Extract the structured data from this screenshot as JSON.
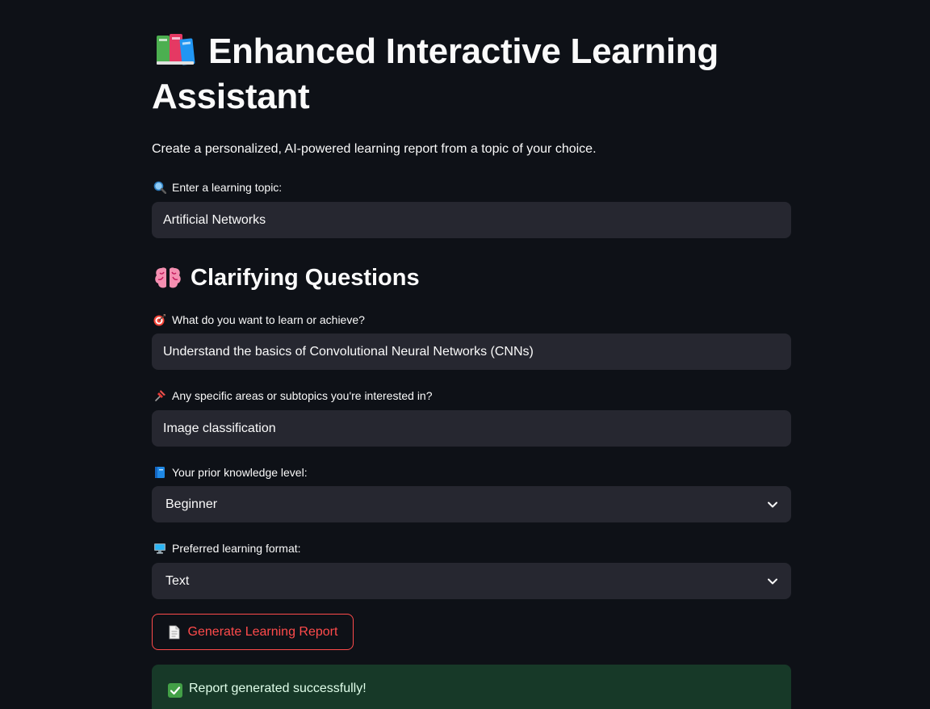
{
  "header": {
    "title": "Enhanced Interactive Learning Assistant",
    "title_icon": "books-icon",
    "subtitle": "Create a personalized, AI-powered learning report from a topic of your choice."
  },
  "topic": {
    "label": "Enter a learning topic:",
    "icon": "magnifier-icon",
    "value": "Artificial Networks"
  },
  "clarifying": {
    "heading": "Clarifying Questions",
    "icon": "brain-icon",
    "goal": {
      "label": "What do you want to learn or achieve?",
      "icon": "target-icon",
      "value": "Understand the basics of Convolutional Neural Networks (CNNs)"
    },
    "areas": {
      "label": "Any specific areas or subtopics you're interested in?",
      "icon": "pushpin-icon",
      "value": "Image classification"
    },
    "knowledge": {
      "label": "Your prior knowledge level:",
      "icon": "blue-book-icon",
      "selected": "Beginner"
    },
    "format": {
      "label": "Preferred learning format:",
      "icon": "computer-icon",
      "selected": "Text"
    }
  },
  "actions": {
    "generate_label": "Generate Learning Report",
    "generate_icon": "document-icon"
  },
  "status": {
    "message": "Report generated successfully!",
    "icon": "check-mark-icon"
  },
  "colors": {
    "background": "#0e1117",
    "field": "#262730",
    "accent": "#ff4b4b",
    "success_bg": "#173928"
  }
}
